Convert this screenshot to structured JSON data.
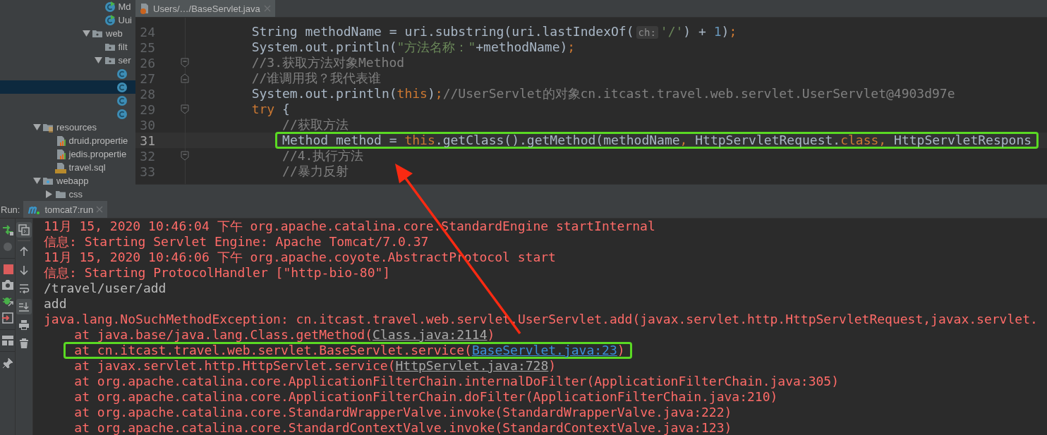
{
  "project_tree": [
    {
      "children": [
        {
          "children": [
            {
              "children": [
                {
                  "children": [
                    {
                      "children": [
                        {
                          "kind": "main-class",
                          "label": "Md",
                          "selected": false
                        },
                        {
                          "kind": "main-class",
                          "label": "Uui",
                          "selected": false
                        }
                      ]
                    },
                    {
                      "kind": "package",
                      "label": "web",
                      "expanded": true,
                      "selected": false,
                      "children": [
                        {
                          "kind": "package",
                          "label": "filt",
                          "selected": false
                        },
                        {
                          "kind": "package",
                          "label": "ser",
                          "expanded": true,
                          "selected": false,
                          "children": [
                            {
                              "kind": "class",
                              "selected": false
                            },
                            {
                              "kind": "class",
                              "selected": true
                            },
                            {
                              "kind": "class",
                              "selected": false
                            },
                            {
                              "kind": "class",
                              "selected": false
                            }
                          ]
                        }
                      ]
                    }
                  ]
                }
              ]
            }
          ]
        }
      ]
    },
    {
      "kind": "resources-folder",
      "label": "resources",
      "expanded": true,
      "selected": false,
      "children": [
        {
          "kind": "properties",
          "label": "druid.propertie",
          "selected": false
        },
        {
          "kind": "properties",
          "label": "jedis.propertie",
          "selected": false
        },
        {
          "kind": "sql",
          "label": "travel.sql",
          "selected": false
        }
      ]
    },
    {
      "kind": "web-folder",
      "label": "webapp",
      "expanded": true,
      "selected": false,
      "children": [
        {
          "kind": "folder",
          "label": "css",
          "expanded": false,
          "selected": false
        }
      ]
    }
  ],
  "editor": {
    "tab": {
      "label": "Users/…/BaseServlet.java",
      "selected": true
    },
    "lines": [
      {
        "number": "24",
        "current": false,
        "fold_start": false,
        "fold_end": false,
        "tokens": [
          {
            "text": "String methodName = uri.substring(uri.lastIndexOf(",
            "kind": "plain"
          },
          {
            "text": "ch:",
            "kind": "hint"
          },
          {
            "text": "'/'",
            "kind": "string"
          },
          {
            "text": ") + ",
            "kind": "plain"
          },
          {
            "text": "1",
            "kind": "number"
          },
          {
            "text": ")",
            "kind": "plain"
          },
          {
            "text": ";",
            "kind": "keyword"
          }
        ]
      },
      {
        "number": "25",
        "current": false,
        "fold_start": false,
        "fold_end": false,
        "tokens": [
          {
            "text": "System.out.println(",
            "kind": "plain"
          },
          {
            "text": "\"方法名称：\"",
            "kind": "string"
          },
          {
            "text": "+methodName)",
            "kind": "plain"
          },
          {
            "text": ";",
            "kind": "keyword"
          }
        ]
      },
      {
        "number": "26",
        "current": false,
        "fold_start": true,
        "fold_end": false,
        "tokens": [
          {
            "text": "//3.获取方法对象Method",
            "kind": "comment"
          }
        ]
      },
      {
        "number": "27",
        "current": false,
        "fold_start": false,
        "fold_end": true,
        "tokens": [
          {
            "text": "//谁调用我？我代表谁",
            "kind": "comment"
          }
        ]
      },
      {
        "number": "28",
        "current": false,
        "fold_start": false,
        "fold_end": false,
        "tokens": [
          {
            "text": "System.out.println(",
            "kind": "plain"
          },
          {
            "text": "this",
            "kind": "keyword"
          },
          {
            "text": ")",
            "kind": "plain"
          },
          {
            "text": ";",
            "kind": "keyword"
          },
          {
            "text": "//UserServlet的对象cn.itcast.travel.web.servlet.UserServlet@4903d97e",
            "kind": "comment"
          }
        ]
      },
      {
        "number": "29",
        "current": false,
        "fold_start": true,
        "fold_end": false,
        "tokens": [
          {
            "text": "try",
            "kind": "keyword"
          },
          {
            "text": " {",
            "kind": "plain"
          }
        ],
        "children": [
          {
            "number": "30",
            "current": false,
            "fold_start": false,
            "fold_end": false,
            "tokens": [
              {
                "text": "//获取方法",
                "kind": "comment"
              }
            ]
          },
          {
            "number": "31",
            "current": true,
            "fold_start": false,
            "fold_end": false,
            "boxed": true,
            "tokens": [
              {
                "text": "Method method = ",
                "kind": "plain"
              },
              {
                "text": "this",
                "kind": "keyword"
              },
              {
                "text": ".getClass().getMethod(methodName",
                "kind": "plain"
              },
              {
                "text": ", ",
                "kind": "keyword"
              },
              {
                "text": "HttpServletRequest.",
                "kind": "plain"
              },
              {
                "text": "class",
                "kind": "keyword"
              },
              {
                "text": ", ",
                "kind": "keyword"
              },
              {
                "text": "HttpServletRespons",
                "kind": "plain"
              }
            ]
          },
          {
            "number": "32",
            "current": false,
            "fold_start": true,
            "fold_end": false,
            "tokens": [
              {
                "text": "//4.执行方法",
                "kind": "comment"
              }
            ]
          },
          {
            "number": "33",
            "current": false,
            "fold_start": false,
            "fold_end": false,
            "tokens": [
              {
                "text": "//暴力反射",
                "kind": "comment"
              }
            ]
          }
        ]
      }
    ]
  },
  "run_panel": {
    "label": "Run:",
    "tab": {
      "label": "tomcat7:run",
      "selected": true
    },
    "toolbar": [
      {
        "kind": "console",
        "on": true
      },
      {
        "kind": "up",
        "on": false
      },
      {
        "kind": "down",
        "on": false
      },
      {
        "kind": "wrap",
        "on": false
      },
      {
        "kind": "scroll-end",
        "on": true
      },
      {
        "kind": "print",
        "on": false
      },
      {
        "kind": "trash",
        "on": false
      }
    ],
    "lines": [
      {
        "tokens": [
          {
            "text": "11月 15, 2020 10:46:04 下午 org.apache.catalina.core.StandardEngine startInternal",
            "kind": "error"
          }
        ]
      },
      {
        "tokens": [
          {
            "text": "信息: Starting Servlet Engine: Apache Tomcat/7.0.37",
            "kind": "error"
          }
        ]
      },
      {
        "tokens": [
          {
            "text": "11月 15, 2020 10:46:06 下午 org.apache.coyote.AbstractProtocol start",
            "kind": "error"
          }
        ]
      },
      {
        "tokens": [
          {
            "text": "信息: Starting ProtocolHandler [\"http-bio-80\"]",
            "kind": "error"
          }
        ]
      },
      {
        "tokens": [
          {
            "text": "/travel/user/add",
            "kind": "output"
          }
        ]
      },
      {
        "tokens": [
          {
            "text": "add",
            "kind": "output"
          }
        ]
      },
      {
        "tokens": [
          {
            "text": "java.lang.NoSuchMethodException: cn.itcast.travel.web.servlet.UserServlet.add(javax.servlet.http.HttpServletRequest,javax.servlet.",
            "kind": "error"
          }
        ],
        "children": [
          {
            "tokens": [
              {
                "text": "at java.base/java.lang.Class.getMethod(",
                "kind": "error"
              },
              {
                "text": "Class.java:2114",
                "kind": "link"
              },
              {
                "text": ")",
                "kind": "error"
              }
            ]
          },
          {
            "boxed": true,
            "tokens": [
              {
                "text": "at cn.itcast.travel.web.servlet.BaseServlet.service(",
                "kind": "error"
              },
              {
                "text": "BaseServlet.java:23",
                "kind": "link-active"
              },
              {
                "text": ")",
                "kind": "error"
              }
            ]
          },
          {
            "tokens": [
              {
                "text": "at javax.servlet.http.HttpServlet.service(",
                "kind": "error"
              },
              {
                "text": "HttpServlet.java:728",
                "kind": "link"
              },
              {
                "text": ")",
                "kind": "error"
              }
            ]
          },
          {
            "tokens": [
              {
                "text": "at org.apache.catalina.core.ApplicationFilterChain.internalDoFilter(ApplicationFilterChain.java:305)",
                "kind": "error"
              }
            ]
          },
          {
            "tokens": [
              {
                "text": "at org.apache.catalina.core.ApplicationFilterChain.doFilter(ApplicationFilterChain.java:210)",
                "kind": "error"
              }
            ]
          },
          {
            "tokens": [
              {
                "text": "at org.apache.catalina.core.StandardWrapperValve.invoke(StandardWrapperValve.java:222)",
                "kind": "error"
              }
            ]
          },
          {
            "tokens": [
              {
                "text": "at org.apache.catalina.core.StandardContextValve.invoke(StandardContextValve.java:123)",
                "kind": "error"
              }
            ]
          }
        ]
      }
    ]
  },
  "annotations": [
    {
      "kind": "arrow"
    }
  ]
}
